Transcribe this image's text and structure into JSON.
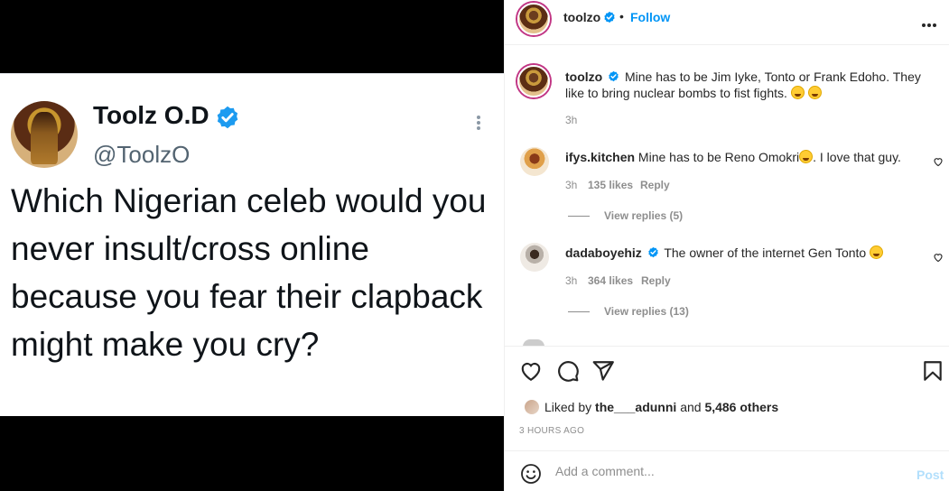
{
  "tweet": {
    "display_name": "Toolz O.D",
    "handle": "@ToolzO",
    "text": "Which Nigerian celeb would you never insult/cross online because you fear their clapback might make you cry?"
  },
  "post": {
    "header": {
      "username": "toolzo",
      "separator": "•",
      "follow_label": "Follow"
    },
    "caption": {
      "username": "toolzo",
      "text": "Mine has to be Jim Iyke, Tonto or Frank Edoho. They like to bring nuclear bombs to fist fights.",
      "time": "3h"
    },
    "comments": [
      {
        "username": "ifys.kitchen",
        "text_before": "Mine has to be Reno Omokri",
        "text_after": ". I love that guy.",
        "time": "3h",
        "likes": "135 likes",
        "reply_label": "Reply",
        "view_replies": "View replies (5)"
      },
      {
        "username": "dadaboyehiz",
        "text": "The owner of the internet Gen Tonto",
        "time": "3h",
        "likes": "364 likes",
        "reply_label": "Reply",
        "view_replies": "View replies (13)"
      }
    ],
    "liked_by": {
      "prefix": "Liked by",
      "user": "the___adunni",
      "and": "and",
      "others": "5,486 others"
    },
    "timestamp": "3 HOURS AGO",
    "composer": {
      "placeholder": "Add a comment...",
      "post_label": "Post"
    }
  },
  "colors": {
    "link_blue": "#0095f6",
    "post_disabled": "#b2dffc",
    "verified_blue": "#1d9bf0",
    "muted": "#8e8e8e"
  },
  "icons": [
    "verified-icon",
    "more-icon",
    "heart-icon",
    "comment-icon",
    "share-icon",
    "bookmark-icon",
    "emoji-icon"
  ]
}
